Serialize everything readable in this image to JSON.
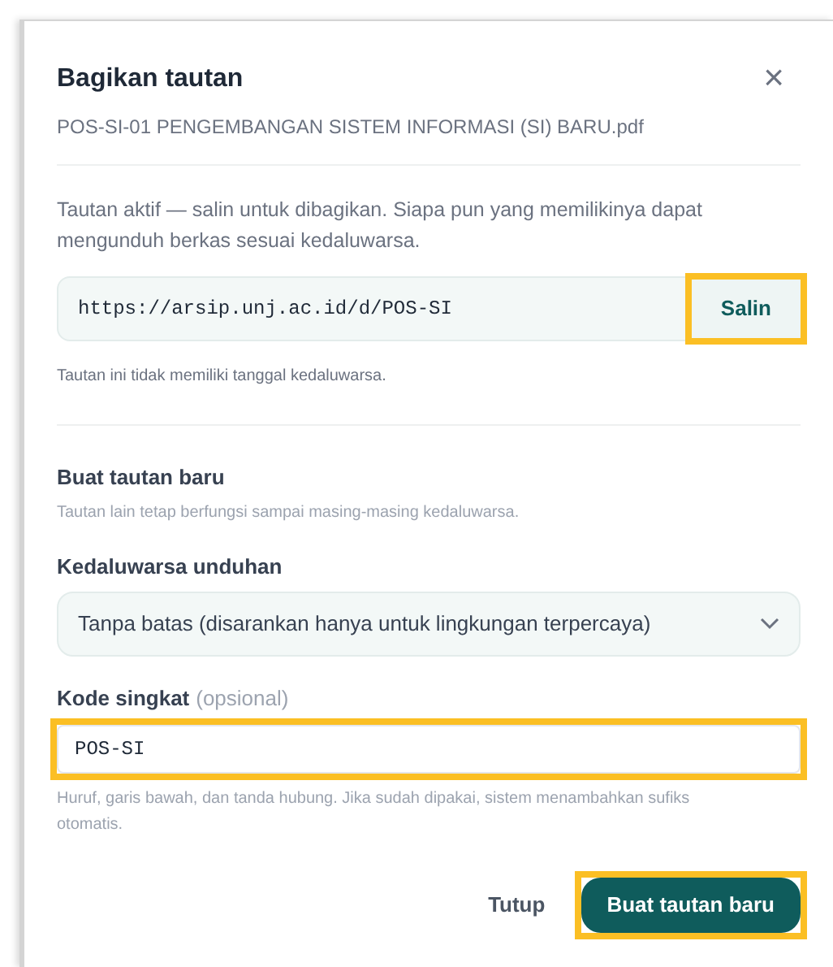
{
  "dialog": {
    "title": "Bagikan tautan",
    "subtitle": "POS-SI-01 PENGEMBANGAN SISTEM INFORMASI (SI) BARU.pdf",
    "close": "×"
  },
  "active_link": {
    "description": "Tautan aktif — salin untuk dibagikan. Siapa pun yang memilikinya dapat mengunduh berkas sesuai kedaluwarsa.",
    "url": "https://arsip.unj.ac.id/d/POS-SI",
    "copy_button": {
      "label": "Salin",
      "highlighted": true
    },
    "note": "Tautan ini tidak memiliki tanggal kedaluwarsa."
  },
  "new_link": {
    "heading": "Buat tautan baru",
    "note": "Tautan lain tetap berfungsi sampai masing-masing kedaluwarsa.",
    "expiry": {
      "label": "Kedaluwarsa unduhan",
      "value": "Tanpa batas (disarankan hanya untuk lingkungan terpercaya)"
    },
    "short_code": {
      "label": "Kode singkat",
      "optional": "(opsional)",
      "value": "POS-SI",
      "highlighted": true,
      "help": "Huruf, garis bawah, dan tanda hubung. Jika sudah dipakai, sistem menambahkan sufiks otomatis."
    }
  },
  "buttons": [
    {
      "kind": "secondary",
      "label": "Tutup",
      "highlighted": false
    },
    {
      "kind": "primary",
      "label": "Buat tautan baru",
      "highlighted": true
    }
  ]
}
